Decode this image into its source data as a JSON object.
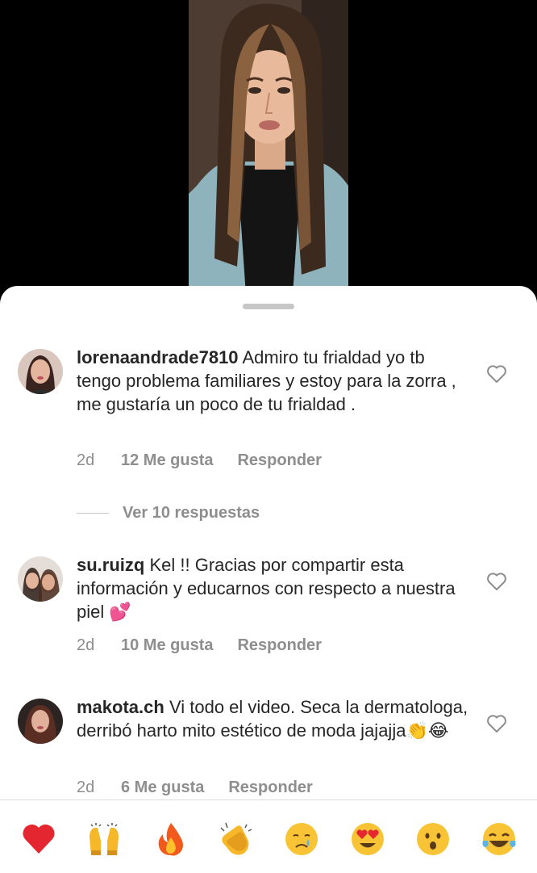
{
  "comments": [
    {
      "username": "lorenaandrade7810",
      "text": "Admiro tu frialdad yo tb tengo problema familiares y estoy para la zorra , me gustaría un poco de tu frialdad .",
      "time": "2d",
      "likes": "12 Me gusta",
      "reply": "Responder",
      "avatar": "avatar-lorena"
    },
    {
      "username": "su.ruizq",
      "text": "Kel !! Gracias por compartir esta información y educarnos con respecto a nuestra piel 💕",
      "time": "2d",
      "likes": "10 Me gusta",
      "reply": "Responder",
      "avatar": "avatar-su"
    },
    {
      "username": "makota.ch",
      "text": "Vi todo el video. Seca la dermatologa, derribó harto mito estético de moda jajajja👏😂",
      "time": "2d",
      "likes": "6 Me gusta",
      "reply": "Responder",
      "avatar": "avatar-makota"
    }
  ],
  "replies_toggle": "Ver 10 respuestas",
  "reactions": [
    {
      "name": "red-heart",
      "glyph": "❤️"
    },
    {
      "name": "raising-hands",
      "glyph": "🙌"
    },
    {
      "name": "fire",
      "glyph": "🔥"
    },
    {
      "name": "clapping-hands",
      "glyph": "👏"
    },
    {
      "name": "crying-face",
      "glyph": "😢"
    },
    {
      "name": "heart-eyes",
      "glyph": "😍"
    },
    {
      "name": "surprised-face",
      "glyph": "😮"
    },
    {
      "name": "laughing-tears",
      "glyph": "😂"
    }
  ],
  "colors": {
    "text": "#262626",
    "muted": "#8e8e8e",
    "background": "#ffffff",
    "video_bg": "#000000"
  }
}
